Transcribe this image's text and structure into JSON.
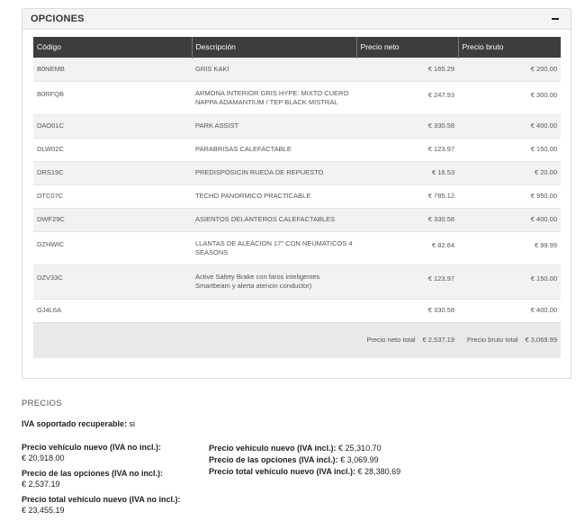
{
  "panel": {
    "title": "OPCIONES",
    "collapse_symbol": "minus-icon"
  },
  "table": {
    "headers": [
      "Código",
      "Descripción",
      "Precio neto",
      "Precio bruto"
    ],
    "rows": [
      {
        "code": "B0NEMB",
        "desc": "GRIS KAKI",
        "desc2": "",
        "neto": "€ 165.29",
        "bruto": "€ 200.00"
      },
      {
        "code": "B0RFQB",
        "desc": "ARMONA INTERIOR GRIS HYPE: MIXTO CUERO",
        "desc2": "NAPPA ADAMANTIUM / TEP BLACK MISTRAL",
        "neto": "€ 247.93",
        "bruto": "€ 300.00"
      },
      {
        "code": "DAO01C",
        "desc": "PARK ASSIST",
        "desc2": "",
        "neto": "€ 330.58",
        "bruto": "€ 400.00"
      },
      {
        "code": "DLW02C",
        "desc": "PARABRISAS CALEFACTABLE",
        "desc2": "",
        "neto": "€ 123.97",
        "bruto": "€ 150.00"
      },
      {
        "code": "DRS19C",
        "desc": "PREDISPOSICIN RUEDA DE REPUESTO",
        "desc2": "",
        "neto": "€ 16.53",
        "bruto": "€ 20.00"
      },
      {
        "code": "DTC07C",
        "desc": "TECHO PANORMICO PRACTICABLE",
        "desc2": "",
        "neto": "€ 785.12",
        "bruto": "€ 950.00"
      },
      {
        "code": "DWF29C",
        "desc": "ASIENTOS DELANTEROS CALEFACTABLES",
        "desc2": "",
        "neto": "€ 330.58",
        "bruto": "€ 400.00"
      },
      {
        "code": "DZHWIC",
        "desc": "LLANTAS DE ALEACION 17\" CON NEUMATICOS 4",
        "desc2": "SEASONS",
        "neto": "€ 82.64",
        "bruto": "€ 99.99"
      },
      {
        "code": "DZV33C",
        "desc": "Active Safety Brake con faros inteligentes",
        "desc2": "Smartbeam y alerta atencin conductor)",
        "neto": "€ 123.97",
        "bruto": "€ 150.00"
      },
      {
        "code": "GJ4L6A",
        "desc": "",
        "desc2": "",
        "neto": "€ 330.58",
        "bruto": "€ 400.00"
      }
    ],
    "totals": {
      "neto_label": "Precio neto total",
      "neto_value": "€ 2,537.19",
      "bruto_label": "Precio bruto total",
      "bruto_value": "€ 3,069.99"
    }
  },
  "precios": {
    "title": "PRECIOS",
    "iva_label": "IVA soportado recuperable:",
    "iva_value": "si",
    "left": [
      {
        "label": "Precio vehículo nuevo (IVA no incl.):",
        "value": "€ 20,918.00"
      },
      {
        "label": "Precio de las opciones (IVA no incl.):",
        "value": "€ 2,537.19"
      },
      {
        "label": "Precio total vehículo nuevo (IVA no incl.):",
        "value": "€ 23,455.19"
      }
    ],
    "right": [
      {
        "label": "Precio vehículo nuevo (IVA incl.):",
        "value": "€ 25,310.70"
      },
      {
        "label": "Precio de las opciones (IVA incl.):",
        "value": "€ 3,069.99"
      },
      {
        "label": "Precio total vehículo nuevo (IVA incl.):",
        "value": "€ 28,380.69"
      }
    ]
  }
}
